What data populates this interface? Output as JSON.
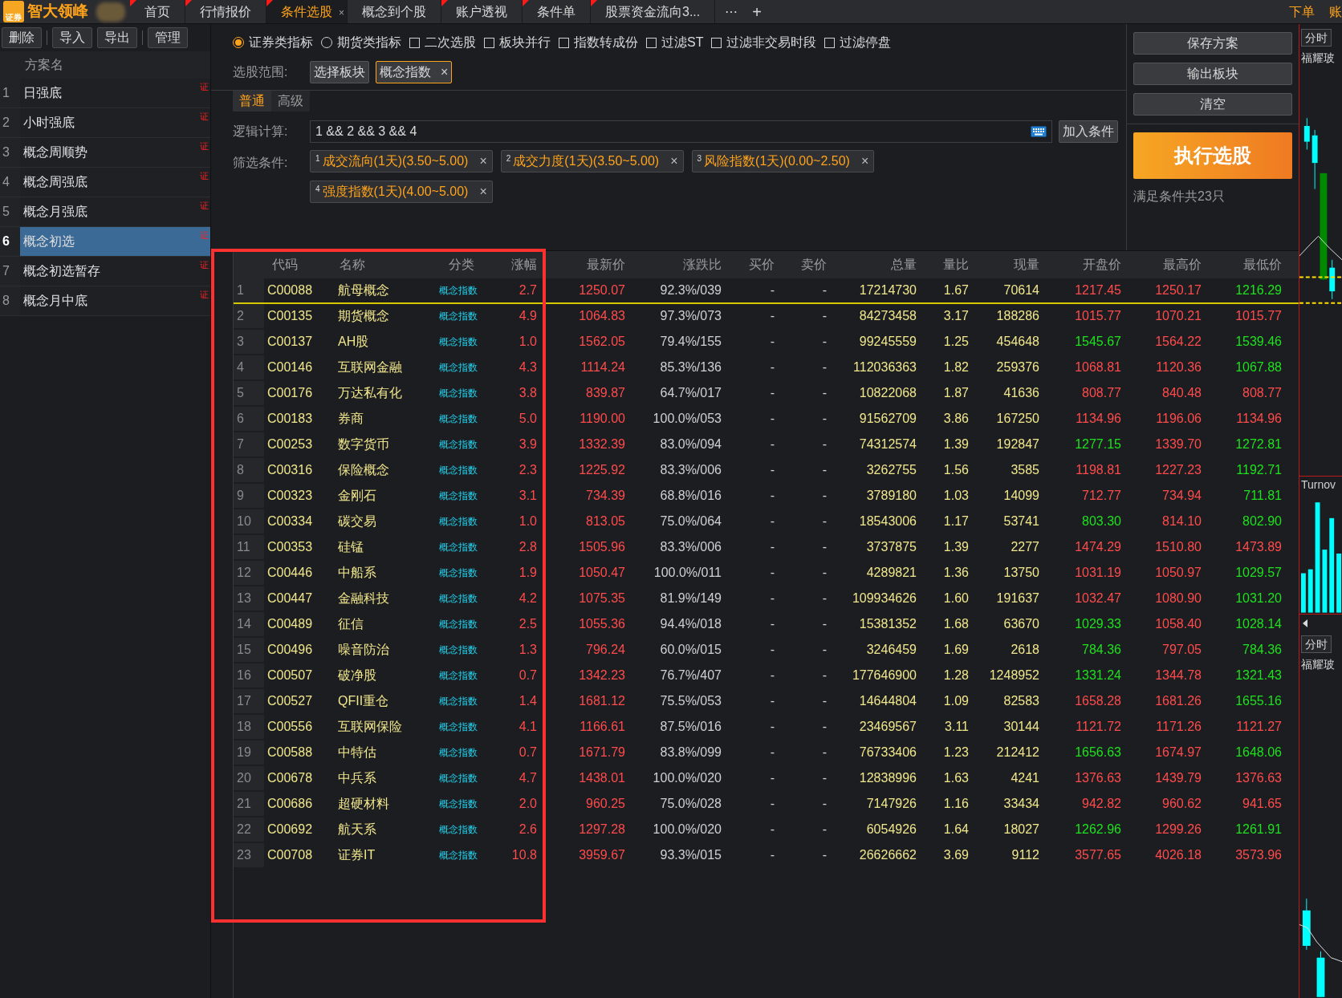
{
  "app": {
    "logo_badge": "证券",
    "name": "智大领峰"
  },
  "tabs": [
    {
      "label": "首页",
      "selected": false,
      "flag": true,
      "closable": false
    },
    {
      "label": "行情报价",
      "selected": false,
      "flag": true,
      "closable": false
    },
    {
      "label": "条件选股",
      "selected": true,
      "flag": true,
      "closable": true
    },
    {
      "label": "概念到个股",
      "selected": false,
      "flag": false,
      "closable": false
    },
    {
      "label": "账户透视",
      "selected": false,
      "flag": true,
      "closable": false
    },
    {
      "label": "条件单",
      "selected": false,
      "flag": true,
      "closable": false
    },
    {
      "label": "股票资金流向3...",
      "selected": false,
      "flag": true,
      "closable": false
    }
  ],
  "tab_more": "⋯",
  "tab_add": "+",
  "close_mark": "×",
  "top_right_links": [
    "下单",
    "账"
  ],
  "toolbar": [
    {
      "label": "删除",
      "separator_before": false
    },
    {
      "label": "导入",
      "separator_before": true
    },
    {
      "label": "导出",
      "separator_before": false
    },
    {
      "label": "管理",
      "separator_before": true
    }
  ],
  "schemes": {
    "header": "方案名",
    "items": [
      {
        "n": "1",
        "name": "日强底",
        "tag": "证",
        "selected": false
      },
      {
        "n": "2",
        "name": "小时强底",
        "tag": "证",
        "selected": false
      },
      {
        "n": "3",
        "name": "概念周顺势",
        "tag": "证",
        "selected": false
      },
      {
        "n": "4",
        "name": "概念周强底",
        "tag": "证",
        "selected": false
      },
      {
        "n": "5",
        "name": "概念月强底",
        "tag": "证",
        "selected": false
      },
      {
        "n": "6",
        "name": "概念初选",
        "tag": "证",
        "selected": true
      },
      {
        "n": "7",
        "name": "概念初选暂存",
        "tag": "证",
        "selected": false
      },
      {
        "n": "8",
        "name": "概念月中底",
        "tag": "证",
        "selected": false
      }
    ]
  },
  "options": [
    {
      "kind": "radio",
      "label": "证券类指标",
      "checked": true
    },
    {
      "kind": "radio",
      "label": "期货类指标",
      "checked": false
    },
    {
      "kind": "checkbox",
      "label": "二次选股",
      "checked": false
    },
    {
      "kind": "checkbox",
      "label": "板块并行",
      "checked": false
    },
    {
      "kind": "checkbox",
      "label": "指数转成份",
      "checked": false
    },
    {
      "kind": "checkbox",
      "label": "过滤ST",
      "checked": false
    },
    {
      "kind": "checkbox",
      "label": "过滤非交易时段",
      "checked": false
    },
    {
      "kind": "checkbox",
      "label": "过滤停盘",
      "checked": false
    }
  ],
  "scope": {
    "label": "选股范围:",
    "button": "选择板块",
    "chips": [
      "概念指数"
    ]
  },
  "mode_tabs": [
    {
      "label": "普通",
      "selected": true
    },
    {
      "label": "高级",
      "selected": false
    }
  ],
  "logic": {
    "label": "逻辑计算:",
    "value": "1 && 2 && 3 && 4",
    "add_button": "加入条件"
  },
  "conditions": {
    "label": "筛选条件:",
    "items": [
      {
        "n": "1",
        "text": "成交流向(1天)(3.50~5.00)"
      },
      {
        "n": "2",
        "text": "成交力度(1天)(3.50~5.00)"
      },
      {
        "n": "3",
        "text": "风险指数(1天)(0.00~2.50)"
      },
      {
        "n": "4",
        "text": "强度指数(1天)(4.00~5.00)"
      }
    ]
  },
  "actions": {
    "buttons": [
      "保存方案",
      "输出板块",
      "清空"
    ],
    "run": "执行选股",
    "result": "满足条件共23只"
  },
  "table": {
    "columns": [
      "代码",
      "名称",
      "分类",
      "涨幅",
      "最新价",
      "涨跌比",
      "买价",
      "卖价",
      "总量",
      "量比",
      "现量",
      "开盘价",
      "最高价",
      "最低价"
    ],
    "rows": [
      {
        "n": "1",
        "code": "C00088",
        "name": "航母概念",
        "category": "概念指数",
        "change": "2.7",
        "last": "1250.07",
        "ratio": "92.3%/039",
        "bid": "-",
        "ask": "-",
        "volume": "17214730",
        "vol_ratio": "1.67",
        "cur_vol": "70614",
        "open": "1217.45",
        "open_up": true,
        "high": "1250.17",
        "high_up": true,
        "low": "1216.29",
        "low_up": false,
        "selected": true
      },
      {
        "n": "2",
        "code": "C00135",
        "name": "期货概念",
        "category": "概念指数",
        "change": "4.9",
        "last": "1064.83",
        "ratio": "97.3%/073",
        "bid": "-",
        "ask": "-",
        "volume": "84273458",
        "vol_ratio": "3.17",
        "cur_vol": "188286",
        "open": "1015.77",
        "open_up": true,
        "high": "1070.21",
        "high_up": true,
        "low": "1015.77",
        "low_up": true,
        "selected": false
      },
      {
        "n": "3",
        "code": "C00137",
        "name": "AH股",
        "category": "概念指数",
        "change": "1.0",
        "last": "1562.05",
        "ratio": "79.4%/155",
        "bid": "-",
        "ask": "-",
        "volume": "99245559",
        "vol_ratio": "1.25",
        "cur_vol": "454648",
        "open": "1545.67",
        "open_up": false,
        "high": "1564.22",
        "high_up": true,
        "low": "1539.46",
        "low_up": false,
        "selected": false
      },
      {
        "n": "4",
        "code": "C00146",
        "name": "互联网金融",
        "category": "概念指数",
        "change": "4.3",
        "last": "1114.24",
        "ratio": "85.3%/136",
        "bid": "-",
        "ask": "-",
        "volume": "112036363",
        "vol_ratio": "1.82",
        "cur_vol": "259376",
        "open": "1068.81",
        "open_up": true,
        "high": "1120.36",
        "high_up": true,
        "low": "1067.88",
        "low_up": false,
        "selected": false
      },
      {
        "n": "5",
        "code": "C00176",
        "name": "万达私有化",
        "category": "概念指数",
        "change": "3.8",
        "last": "839.87",
        "ratio": "64.7%/017",
        "bid": "-",
        "ask": "-",
        "volume": "10822068",
        "vol_ratio": "1.87",
        "cur_vol": "41636",
        "open": "808.77",
        "open_up": true,
        "high": "840.48",
        "high_up": true,
        "low": "808.77",
        "low_up": true,
        "selected": false
      },
      {
        "n": "6",
        "code": "C00183",
        "name": "券商",
        "category": "概念指数",
        "change": "5.0",
        "last": "1190.00",
        "ratio": "100.0%/053",
        "bid": "-",
        "ask": "-",
        "volume": "91562709",
        "vol_ratio": "3.86",
        "cur_vol": "167250",
        "open": "1134.96",
        "open_up": true,
        "high": "1196.06",
        "high_up": true,
        "low": "1134.96",
        "low_up": true,
        "selected": false
      },
      {
        "n": "7",
        "code": "C00253",
        "name": "数字货币",
        "category": "概念指数",
        "change": "3.9",
        "last": "1332.39",
        "ratio": "83.0%/094",
        "bid": "-",
        "ask": "-",
        "volume": "74312574",
        "vol_ratio": "1.39",
        "cur_vol": "192847",
        "open": "1277.15",
        "open_up": false,
        "high": "1339.70",
        "high_up": true,
        "low": "1272.81",
        "low_up": false,
        "selected": false
      },
      {
        "n": "8",
        "code": "C00316",
        "name": "保险概念",
        "category": "概念指数",
        "change": "2.3",
        "last": "1225.92",
        "ratio": "83.3%/006",
        "bid": "-",
        "ask": "-",
        "volume": "3262755",
        "vol_ratio": "1.56",
        "cur_vol": "3585",
        "open": "1198.81",
        "open_up": true,
        "high": "1227.23",
        "high_up": true,
        "low": "1192.71",
        "low_up": false,
        "selected": false
      },
      {
        "n": "9",
        "code": "C00323",
        "name": "金刚石",
        "category": "概念指数",
        "change": "3.1",
        "last": "734.39",
        "ratio": "68.8%/016",
        "bid": "-",
        "ask": "-",
        "volume": "3789180",
        "vol_ratio": "1.03",
        "cur_vol": "14099",
        "open": "712.77",
        "open_up": true,
        "high": "734.94",
        "high_up": true,
        "low": "711.81",
        "low_up": false,
        "selected": false
      },
      {
        "n": "10",
        "code": "C00334",
        "name": "碳交易",
        "category": "概念指数",
        "change": "1.0",
        "last": "813.05",
        "ratio": "75.0%/064",
        "bid": "-",
        "ask": "-",
        "volume": "18543006",
        "vol_ratio": "1.17",
        "cur_vol": "53741",
        "open": "803.30",
        "open_up": false,
        "high": "814.10",
        "high_up": true,
        "low": "802.90",
        "low_up": false,
        "selected": false
      },
      {
        "n": "11",
        "code": "C00353",
        "name": "硅锰",
        "category": "概念指数",
        "change": "2.8",
        "last": "1505.96",
        "ratio": "83.3%/006",
        "bid": "-",
        "ask": "-",
        "volume": "3737875",
        "vol_ratio": "1.39",
        "cur_vol": "2277",
        "open": "1474.29",
        "open_up": true,
        "high": "1510.80",
        "high_up": true,
        "low": "1473.89",
        "low_up": true,
        "selected": false
      },
      {
        "n": "12",
        "code": "C00446",
        "name": "中船系",
        "category": "概念指数",
        "change": "1.9",
        "last": "1050.47",
        "ratio": "100.0%/011",
        "bid": "-",
        "ask": "-",
        "volume": "4289821",
        "vol_ratio": "1.36",
        "cur_vol": "13750",
        "open": "1031.19",
        "open_up": true,
        "high": "1050.97",
        "high_up": true,
        "low": "1029.57",
        "low_up": false,
        "selected": false
      },
      {
        "n": "13",
        "code": "C00447",
        "name": "金融科技",
        "category": "概念指数",
        "change": "4.2",
        "last": "1075.35",
        "ratio": "81.9%/149",
        "bid": "-",
        "ask": "-",
        "volume": "109934626",
        "vol_ratio": "1.60",
        "cur_vol": "191637",
        "open": "1032.47",
        "open_up": true,
        "high": "1080.90",
        "high_up": true,
        "low": "1031.20",
        "low_up": false,
        "selected": false
      },
      {
        "n": "14",
        "code": "C00489",
        "name": "征信",
        "category": "概念指数",
        "change": "2.5",
        "last": "1055.36",
        "ratio": "94.4%/018",
        "bid": "-",
        "ask": "-",
        "volume": "15381352",
        "vol_ratio": "1.68",
        "cur_vol": "63670",
        "open": "1029.33",
        "open_up": false,
        "high": "1058.40",
        "high_up": true,
        "low": "1028.14",
        "low_up": false,
        "selected": false
      },
      {
        "n": "15",
        "code": "C00496",
        "name": "噪音防治",
        "category": "概念指数",
        "change": "1.3",
        "last": "796.24",
        "ratio": "60.0%/015",
        "bid": "-",
        "ask": "-",
        "volume": "3246459",
        "vol_ratio": "1.69",
        "cur_vol": "2618",
        "open": "784.36",
        "open_up": false,
        "high": "797.05",
        "high_up": true,
        "low": "784.36",
        "low_up": false,
        "selected": false
      },
      {
        "n": "16",
        "code": "C00507",
        "name": "破净股",
        "category": "概念指数",
        "change": "0.7",
        "last": "1342.23",
        "ratio": "76.7%/407",
        "bid": "-",
        "ask": "-",
        "volume": "177646900",
        "vol_ratio": "1.28",
        "cur_vol": "1248952",
        "open": "1331.24",
        "open_up": false,
        "high": "1344.78",
        "high_up": true,
        "low": "1321.43",
        "low_up": false,
        "selected": false
      },
      {
        "n": "17",
        "code": "C00527",
        "name": "QFII重仓",
        "category": "概念指数",
        "change": "1.4",
        "last": "1681.12",
        "ratio": "75.5%/053",
        "bid": "-",
        "ask": "-",
        "volume": "14644804",
        "vol_ratio": "1.09",
        "cur_vol": "82583",
        "open": "1658.28",
        "open_up": true,
        "high": "1681.26",
        "high_up": true,
        "low": "1655.16",
        "low_up": false,
        "selected": false
      },
      {
        "n": "18",
        "code": "C00556",
        "name": "互联网保险",
        "category": "概念指数",
        "change": "4.1",
        "last": "1166.61",
        "ratio": "87.5%/016",
        "bid": "-",
        "ask": "-",
        "volume": "23469567",
        "vol_ratio": "3.11",
        "cur_vol": "30144",
        "open": "1121.72",
        "open_up": true,
        "high": "1171.26",
        "high_up": true,
        "low": "1121.27",
        "low_up": true,
        "selected": false
      },
      {
        "n": "19",
        "code": "C00588",
        "name": "中特估",
        "category": "概念指数",
        "change": "0.7",
        "last": "1671.79",
        "ratio": "83.8%/099",
        "bid": "-",
        "ask": "-",
        "volume": "76733406",
        "vol_ratio": "1.23",
        "cur_vol": "212412",
        "open": "1656.63",
        "open_up": false,
        "high": "1674.97",
        "high_up": true,
        "low": "1648.06",
        "low_up": false,
        "selected": false
      },
      {
        "n": "20",
        "code": "C00678",
        "name": "中兵系",
        "category": "概念指数",
        "change": "4.7",
        "last": "1438.01",
        "ratio": "100.0%/020",
        "bid": "-",
        "ask": "-",
        "volume": "12838996",
        "vol_ratio": "1.63",
        "cur_vol": "4241",
        "open": "1376.63",
        "open_up": true,
        "high": "1439.79",
        "high_up": true,
        "low": "1376.63",
        "low_up": true,
        "selected": false
      },
      {
        "n": "21",
        "code": "C00686",
        "name": "超硬材料",
        "category": "概念指数",
        "change": "2.0",
        "last": "960.25",
        "ratio": "75.0%/028",
        "bid": "-",
        "ask": "-",
        "volume": "7147926",
        "vol_ratio": "1.16",
        "cur_vol": "33434",
        "open": "942.82",
        "open_up": true,
        "high": "960.62",
        "high_up": true,
        "low": "941.65",
        "low_up": true,
        "selected": false
      },
      {
        "n": "22",
        "code": "C00692",
        "name": "航天系",
        "category": "概念指数",
        "change": "2.6",
        "last": "1297.28",
        "ratio": "100.0%/020",
        "bid": "-",
        "ask": "-",
        "volume": "6054926",
        "vol_ratio": "1.64",
        "cur_vol": "18027",
        "open": "1262.96",
        "open_up": false,
        "high": "1299.26",
        "high_up": true,
        "low": "1261.91",
        "low_up": false,
        "selected": false
      },
      {
        "n": "23",
        "code": "C00708",
        "name": "证券IT",
        "category": "概念指数",
        "change": "10.8",
        "last": "3959.67",
        "ratio": "93.3%/015",
        "bid": "-",
        "ask": "-",
        "volume": "26626662",
        "vol_ratio": "3.69",
        "cur_vol": "9112",
        "open": "3577.65",
        "open_up": true,
        "high": "4026.18",
        "high_up": true,
        "low": "3573.96",
        "low_up": true,
        "selected": false
      }
    ]
  },
  "side_chart": {
    "button": "分时",
    "stock": "福耀玻",
    "volume_label": "Turnov",
    "button_2": "分时",
    "stock_2": "福耀玻"
  }
}
